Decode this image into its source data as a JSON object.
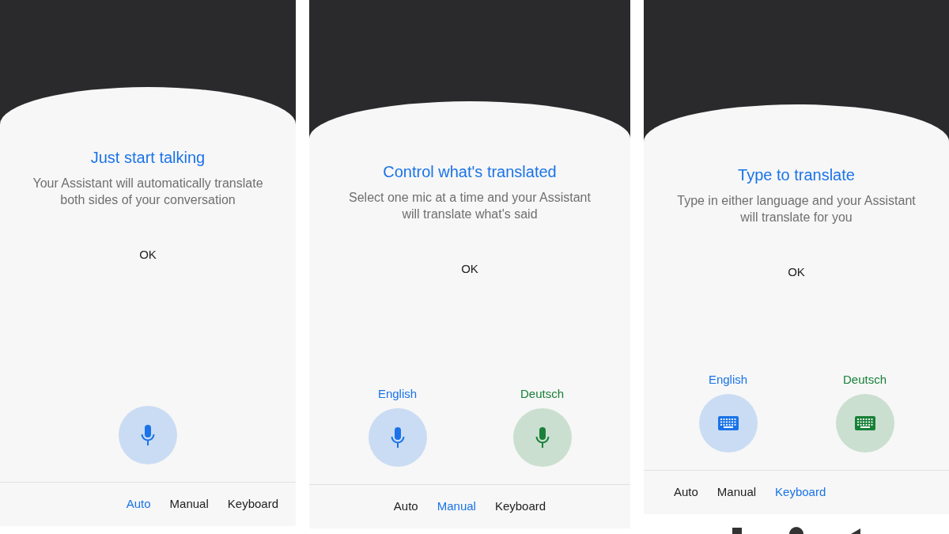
{
  "panels": [
    {
      "title": "Just start talking",
      "body": "Your Assistant will automatically translate both sides of your conversation",
      "ok": "OK",
      "mics": [
        {
          "kind": "mic",
          "color": "#1a73e8"
        }
      ],
      "tabs": [
        {
          "label": "Auto",
          "selected": true
        },
        {
          "label": "Manual",
          "selected": false
        },
        {
          "label": "Keyboard",
          "selected": false
        }
      ],
      "nav_bar": false
    },
    {
      "title": "Control what's translated",
      "body": "Select one mic at a time and your Assistant will translate what's said",
      "ok": "OK",
      "mics": [
        {
          "kind": "mic",
          "label": "English",
          "color": "#1a73e8"
        },
        {
          "kind": "mic",
          "label": "Deutsch",
          "color": "#188038"
        }
      ],
      "tabs": [
        {
          "label": "Auto",
          "selected": false
        },
        {
          "label": "Manual",
          "selected": true
        },
        {
          "label": "Keyboard",
          "selected": false
        }
      ],
      "nav_bar": false
    },
    {
      "title": "Type to translate",
      "body": "Type in either language and your Assistant will translate for you",
      "ok": "OK",
      "mics": [
        {
          "kind": "keyboard",
          "label": "English",
          "color": "#1a73e8"
        },
        {
          "kind": "keyboard",
          "label": "Deutsch",
          "color": "#188038"
        }
      ],
      "tabs": [
        {
          "label": "Auto",
          "selected": false
        },
        {
          "label": "Manual",
          "selected": false
        },
        {
          "label": "Keyboard",
          "selected": true
        }
      ],
      "nav_bar": true
    }
  ]
}
